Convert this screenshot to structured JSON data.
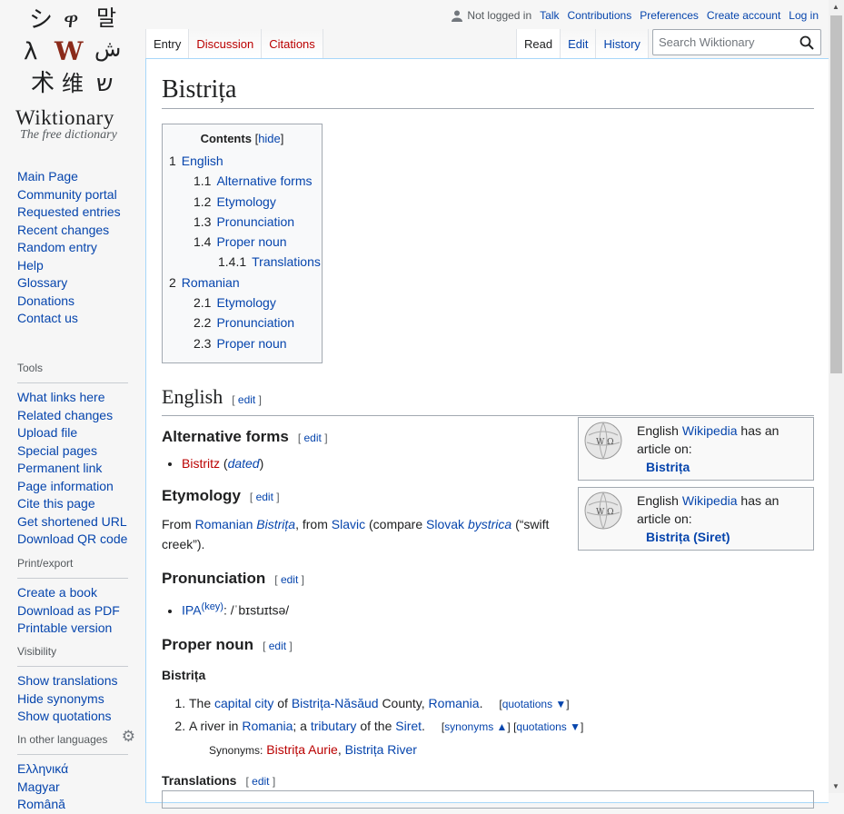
{
  "site": {
    "name": "Wiktionary",
    "tagline": "The free dictionary"
  },
  "nav": {
    "items": [
      "Main Page",
      "Community portal",
      "Requested entries",
      "Recent changes",
      "Random entry",
      "Help",
      "Glossary",
      "Donations",
      "Contact us"
    ]
  },
  "tools": {
    "heading": "Tools",
    "items": [
      "What links here",
      "Related changes",
      "Upload file",
      "Special pages",
      "Permanent link",
      "Page information",
      "Cite this page",
      "Get shortened URL",
      "Download QR code"
    ]
  },
  "printexport": {
    "heading": "Print/export",
    "items": [
      "Create a book",
      "Download as PDF",
      "Printable version"
    ]
  },
  "visibility": {
    "heading": "Visibility",
    "items": [
      "Show translations",
      "Hide synonyms",
      "Show quotations"
    ]
  },
  "languages": {
    "heading": "In other languages",
    "items": [
      "Ελληνικά",
      "Magyar",
      "Română"
    ]
  },
  "personal": {
    "status": "Not logged in",
    "links": [
      "Talk",
      "Contributions",
      "Preferences",
      "Create account",
      "Log in"
    ]
  },
  "ns_tabs": [
    "Entry",
    "Discussion",
    "Citations"
  ],
  "view_tabs": [
    "Read",
    "Edit",
    "History"
  ],
  "search": {
    "placeholder": "Search Wiktionary"
  },
  "page": {
    "title": "Bistrița"
  },
  "toc": {
    "title": "Contents",
    "hide": "hide",
    "items": [
      {
        "num": "1",
        "label": "English",
        "level": 1
      },
      {
        "num": "1.1",
        "label": "Alternative forms",
        "level": 2
      },
      {
        "num": "1.2",
        "label": "Etymology",
        "level": 2
      },
      {
        "num": "1.3",
        "label": "Pronunciation",
        "level": 2
      },
      {
        "num": "1.4",
        "label": "Proper noun",
        "level": 2
      },
      {
        "num": "1.4.1",
        "label": "Translations",
        "level": 3
      },
      {
        "num": "2",
        "label": "Romanian",
        "level": 1
      },
      {
        "num": "2.1",
        "label": "Etymology",
        "level": 2
      },
      {
        "num": "2.2",
        "label": "Pronunciation",
        "level": 2
      },
      {
        "num": "2.3",
        "label": "Proper noun",
        "level": 2
      }
    ]
  },
  "edit_label": "edit",
  "english": {
    "heading": "English",
    "altforms": {
      "heading": "Alternative forms",
      "word": "Bistritz",
      "qualifier": "dated"
    },
    "etymology": {
      "heading": "Etymology",
      "from": "From",
      "romanian": "Romanian",
      "term": "Bistrița",
      "from2": ", from",
      "slavic": "Slavic",
      "compare": "(compare",
      "slovak": "Slovak",
      "bystrica": "bystrica",
      "gloss": "(“swift creek”)."
    },
    "pronunciation": {
      "heading": "Pronunciation",
      "ipa": "IPA",
      "key": "(key)",
      "transcription": ": /ˈbɪstɹɪtsə/"
    },
    "propernoun": {
      "heading": "Proper noun",
      "headword": "Bistrița",
      "def1": {
        "pre": "The",
        "l1": "capital city",
        "of": "of",
        "l2": "Bistrița-Năsăud",
        "county": "County,",
        "l3": "Romania",
        "end": ".",
        "quot": "quotations ▼"
      },
      "def2": {
        "pre": "A river in",
        "l1": "Romania",
        "mid": "; a",
        "l2": "tributary",
        "of": "of the",
        "l3": "Siret",
        "end": ".",
        "syn": "synonyms ▲",
        "quot": "quotations ▼"
      },
      "synonyms": {
        "label": "Synonyms:",
        "s1": "Bistrița Aurie",
        "s2": "Bistrița River"
      }
    },
    "translations": {
      "heading": "Translations"
    }
  },
  "wp1": {
    "pre": "English",
    "link": "Wikipedia",
    "post": "has an article on:",
    "article": "Bistrița"
  },
  "wp2": {
    "pre": "English",
    "link": "Wikipedia",
    "post": "has an article on:",
    "article": "Bistrița (Siret)"
  }
}
